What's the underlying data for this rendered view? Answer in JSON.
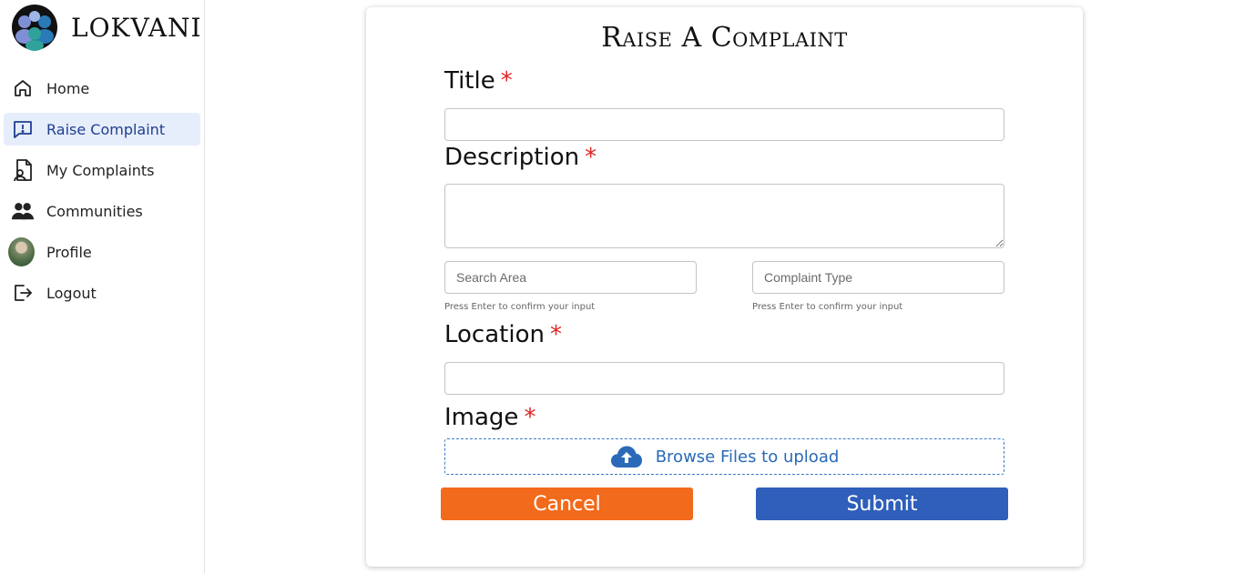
{
  "brand": {
    "name": "LOKVANI"
  },
  "sidebar": {
    "items": [
      {
        "label": "Home",
        "icon": "home-icon",
        "active": false
      },
      {
        "label": "Raise Complaint",
        "icon": "report-icon",
        "active": true
      },
      {
        "label": "My Complaints",
        "icon": "document-user-icon",
        "active": false
      },
      {
        "label": "Communities",
        "icon": "people-icon",
        "active": false
      },
      {
        "label": "Profile",
        "icon": "avatar",
        "active": false
      },
      {
        "label": "Logout",
        "icon": "logout-icon",
        "active": false
      }
    ]
  },
  "form": {
    "title": "Raise A Complaint",
    "required_mark": "*",
    "title_label": "Title",
    "title_value": "",
    "description_label": "Description",
    "description_value": "",
    "search_area_placeholder": "Search Area",
    "search_area_hint": "Press Enter to confirm your input",
    "complaint_type_placeholder": "Complaint Type",
    "complaint_type_hint": "Press Enter to confirm your input",
    "location_label": "Location",
    "location_value": "",
    "image_label": "Image",
    "upload_label": "Browse Files to upload",
    "cancel_label": "Cancel",
    "submit_label": "Submit"
  },
  "colors": {
    "active_bg": "#e6edfb",
    "required": "#e02424",
    "cancel": "#f26a1b",
    "submit": "#2f5fba",
    "upload": "#2a6ab8"
  }
}
